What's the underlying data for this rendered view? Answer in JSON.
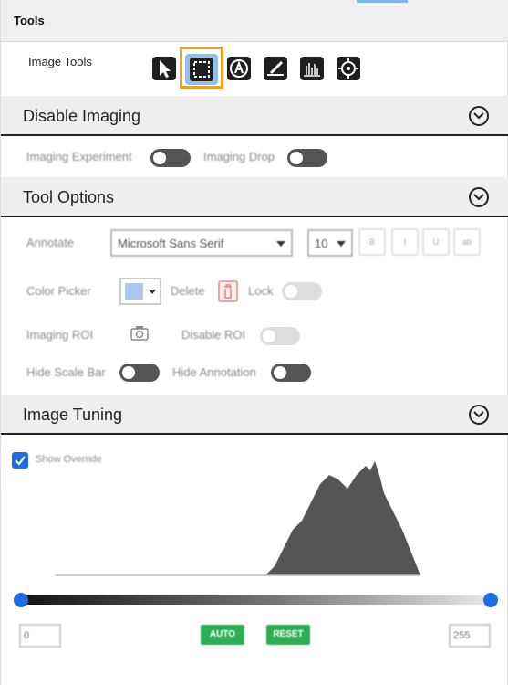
{
  "header": {
    "title": "Tools"
  },
  "image_tools": {
    "label": "Image Tools",
    "buttons": [
      "pointer-icon",
      "rectangle-select-icon",
      "annotate-icon",
      "ruler-icon",
      "histogram-icon",
      "crosshair-icon"
    ],
    "selected": "rectangle-select-icon"
  },
  "sections": {
    "disable_imaging": "Disable Imaging",
    "tool_options": "Tool Options",
    "image_tuning": "Image Tuning"
  },
  "disable_imaging": {
    "imaging_experiment": "Imaging Experiment",
    "imaging_drop": "Imaging Drop"
  },
  "tool_options": {
    "annotate_label": "Annotate",
    "font_value": "Microsoft Sans Serif",
    "size_value": "10",
    "format_buttons": [
      "B",
      "I",
      "U",
      "ab"
    ],
    "color_picker_label": "Color Picker",
    "delete_label": "Delete",
    "lock_label": "Lock",
    "imaging_roi_label": "Imaging ROI",
    "disable_roi_label": "Disable ROI",
    "hide_scale_bar_label": "Hide Scale Bar",
    "hide_annotation_label": "Hide Annotation",
    "colors": {
      "picker": "#a9c9f0"
    }
  },
  "image_tuning": {
    "show_override_label": "Show Override",
    "show_override_checked": true,
    "min_value": "0",
    "max_value": "255",
    "auto_label": "AUTO",
    "reset_label": "RESET"
  },
  "colors": {
    "accent": "#1d6fe0",
    "selection": "#f0a21c",
    "green": "#2eae54"
  }
}
